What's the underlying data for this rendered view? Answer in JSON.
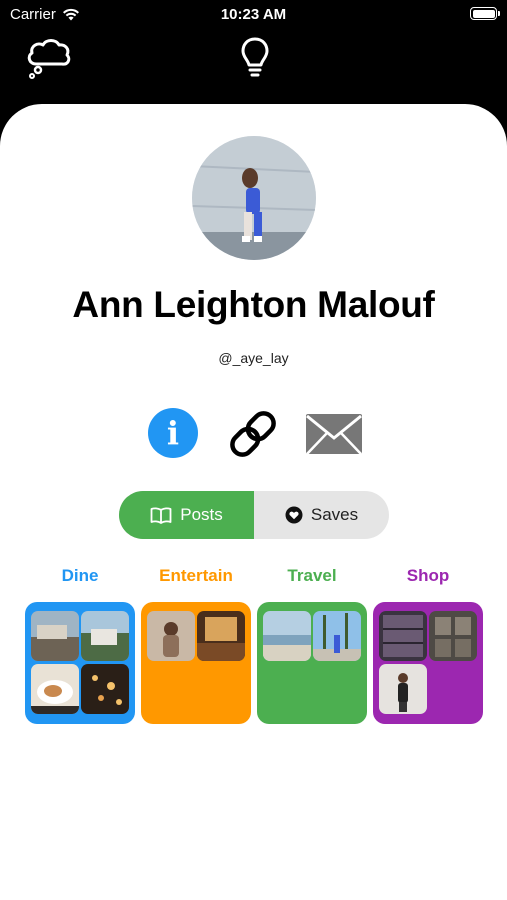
{
  "status_bar": {
    "carrier": "Carrier",
    "time": "10:23 AM"
  },
  "nav": {
    "left_icon": "thought-cloud-icon",
    "center_icon": "lightbulb-icon"
  },
  "profile": {
    "name": "Ann Leighton Malouf",
    "handle": "@_aye_lay"
  },
  "actions": {
    "info_glyph": "i",
    "icons": [
      "info-icon",
      "link-icon",
      "mail-icon"
    ]
  },
  "toggle": {
    "posts_label": "Posts",
    "saves_label": "Saves",
    "selected": "Posts"
  },
  "categories": [
    {
      "label": "Dine",
      "color": "#2196f3"
    },
    {
      "label": "Entertain",
      "color": "#ff9800"
    },
    {
      "label": "Travel",
      "color": "#4caf50"
    },
    {
      "label": "Shop",
      "color": "#9c27b0"
    }
  ]
}
